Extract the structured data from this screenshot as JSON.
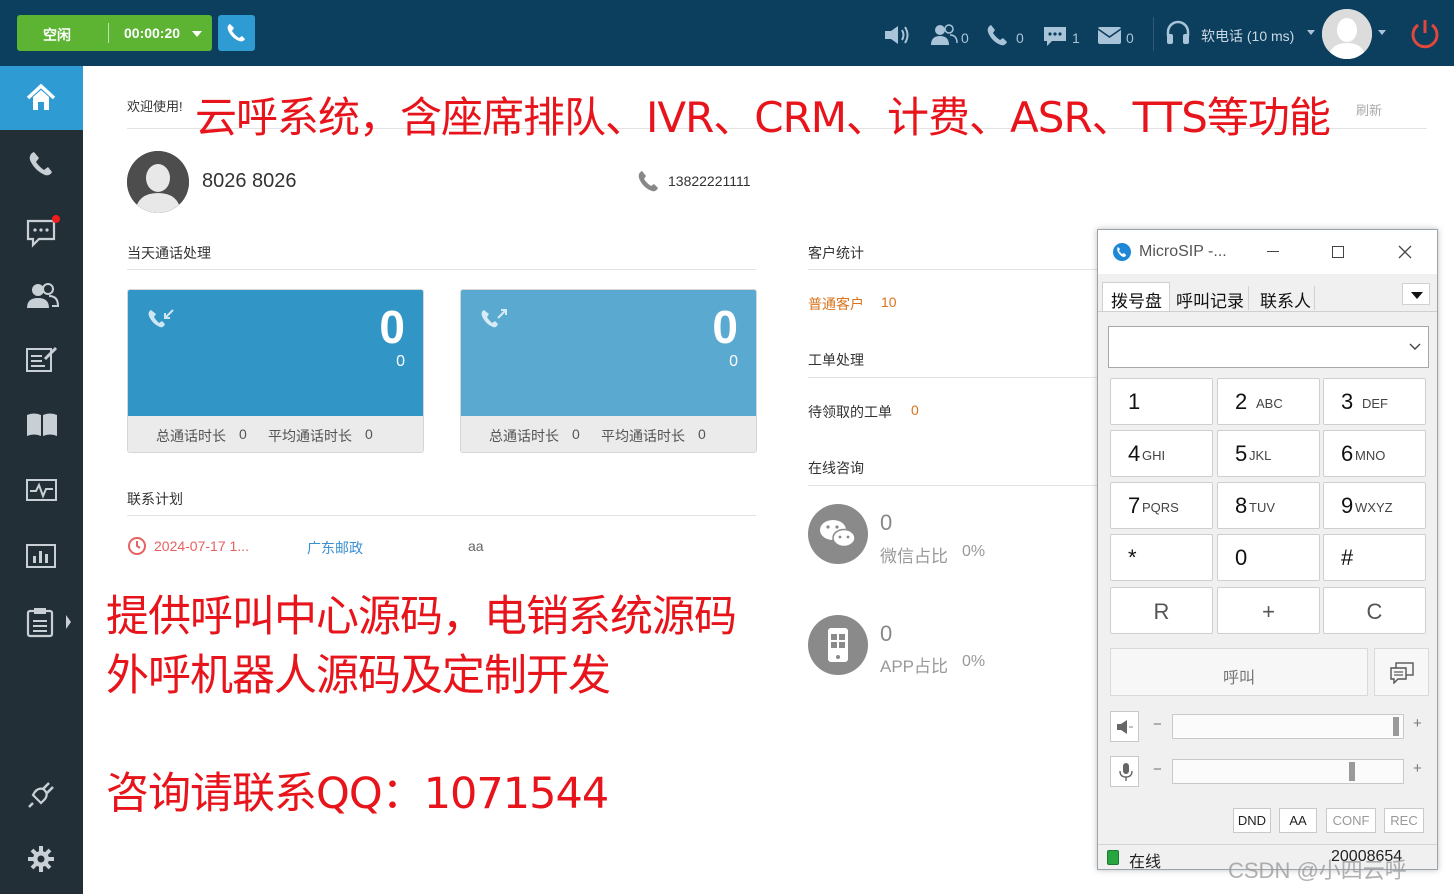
{
  "topbar": {
    "status_label": "空闲",
    "timer": "00:00:20",
    "counts": {
      "agents": "0",
      "calls": "0",
      "chats": "1",
      "messages": "0"
    },
    "softphone_label": "软电话 (10 ms)"
  },
  "welcome": "欢迎使用!",
  "profile": {
    "name": "8026  8026",
    "phone": "13822221111"
  },
  "today_calls": {
    "title": "当天通话处理",
    "cards": [
      {
        "big": "0",
        "small": "0",
        "total_label": "总通话时长",
        "total": "0",
        "avg_label": "平均通话时长",
        "avg": "0"
      },
      {
        "big": "0",
        "small": "0",
        "total_label": "总通话时长",
        "total": "0",
        "avg_label": "平均通话时长",
        "avg": "0"
      }
    ]
  },
  "contact_plan": {
    "title": "联系计划",
    "row": {
      "date": "2024-07-17 1...",
      "company": "广东邮政",
      "note": "aa"
    }
  },
  "customer_stats": {
    "title": "客户统计",
    "label": "普通客户",
    "count": "10"
  },
  "work_orders": {
    "title": "工单处理",
    "label": "待领取的工单",
    "count": "0"
  },
  "online_consult": {
    "title": "在线咨询",
    "wechat": {
      "count": "0",
      "label": "微信占比",
      "pct": "0%"
    },
    "app": {
      "count": "0",
      "label": "APP占比",
      "pct": "0%"
    }
  },
  "overlay": {
    "headline": "云呼系统，含座席排队、IVR、CRM、计费、ASR、TTS等功能",
    "line1": "提供呼叫中心源码，电销系统源码",
    "line2": "外呼机器人源码及定制开发",
    "line3": "咨询请联系QQ：1071544"
  },
  "hidden_button": "刷新",
  "microsip": {
    "title": "MicroSIP -...",
    "tabs": [
      "拨号盘",
      "呼叫记录",
      "联系人"
    ],
    "keys": [
      {
        "d": "1",
        "l": ""
      },
      {
        "d": "2",
        "l": "ABC"
      },
      {
        "d": "3",
        "l": "DEF"
      },
      {
        "d": "4",
        "l": "GHI"
      },
      {
        "d": "5",
        "l": "JKL"
      },
      {
        "d": "6",
        "l": "MNO"
      },
      {
        "d": "7",
        "l": "PQRS"
      },
      {
        "d": "8",
        "l": "TUV"
      },
      {
        "d": "9",
        "l": "WXYZ"
      },
      {
        "d": "*",
        "l": ""
      },
      {
        "d": "0",
        "l": ""
      },
      {
        "d": "#",
        "l": ""
      }
    ],
    "func_keys": [
      "R",
      "+",
      "C"
    ],
    "call_label": "呼叫",
    "minus": "−",
    "plus": "+",
    "buttons": [
      "DND",
      "AA",
      "CONF",
      "REC"
    ],
    "status": "在线",
    "number": "20008654"
  },
  "watermark": "CSDN @小四云呼"
}
